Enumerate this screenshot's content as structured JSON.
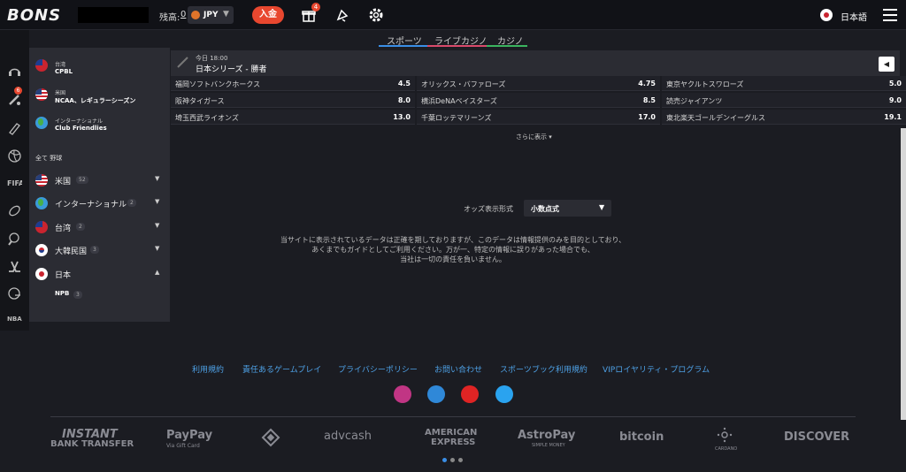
{
  "header": {
    "logo": "BONS",
    "balance_label": "残高:",
    "balance_value": "0",
    "currency": "JPY",
    "deposit_label": "入金",
    "gift_badge": "4",
    "language": "日本語"
  },
  "tabs": [
    {
      "label": "スポーツ",
      "color": "#3a8ee6"
    },
    {
      "label": "ライブカジノ",
      "color": "#d94a6b"
    },
    {
      "label": "カジノ",
      "color": "#3bb45f"
    }
  ],
  "sidebar": {
    "pinned": [
      {
        "line1": "台湾",
        "line2": "CPBL"
      },
      {
        "line1": "米国",
        "line2": "NCAA、レギュラーシーズン"
      },
      {
        "line1": "インターナショナル",
        "line2": "Club Friendlies"
      }
    ],
    "section_title": "全て 野球",
    "countries": [
      {
        "label": "米国",
        "count": "52"
      },
      {
        "label": "インターナショナル",
        "count": "2"
      },
      {
        "label": "台湾",
        "count": "2"
      },
      {
        "label": "大韓民国",
        "count": "3"
      },
      {
        "label": "日本",
        "count": ""
      }
    ],
    "expanded_league": {
      "label": "NPB",
      "count": "3"
    }
  },
  "event": {
    "time": "今日 18:00",
    "name": "日本シリーズ - 勝者",
    "odds": [
      {
        "team": "福岡ソフトバンクホークス",
        "value": "4.5"
      },
      {
        "team": "オリックス・バファローズ",
        "value": "4.75"
      },
      {
        "team": "東京ヤクルトスワローズ",
        "value": "5.0"
      },
      {
        "team": "阪神タイガース",
        "value": "8.0"
      },
      {
        "team": "横浜DeNAベイスターズ",
        "value": "8.5"
      },
      {
        "team": "読売ジャイアンツ",
        "value": "9.0"
      },
      {
        "team": "埼玉西武ライオンズ",
        "value": "13.0"
      },
      {
        "team": "千葉ロッテマリーンズ",
        "value": "17.0"
      },
      {
        "team": "東北楽天ゴールデンイーグルス",
        "value": "19.1"
      }
    ],
    "more_label": "さらに表示 ▾"
  },
  "odds_format": {
    "label": "オッズ表示形式",
    "value": "小数点式"
  },
  "disclaimer": [
    "当サイトに表示されているデータは正確を期しておりますが、このデータは情報提供のみを目的としており、",
    "あくまでもガイドとしてご利用ください。万が一、特定の情報に誤りがあった場合でも、",
    "当社は一切の責任を負いません。"
  ],
  "footer": {
    "links": [
      "利用規約",
      "責任あるゲームプレイ",
      "プライバシーポリシー",
      "お問い合わせ",
      "スポーツブック利用規約",
      "VIPロイヤリティ・プログラム"
    ],
    "social": [
      {
        "icon": "instagram-icon",
        "color": "#c13584"
      },
      {
        "icon": "blog-icon",
        "color": "#2f88d8"
      },
      {
        "icon": "youtube-icon",
        "color": "#e02424"
      },
      {
        "icon": "twitter-icon",
        "color": "#2aa3ef"
      }
    ],
    "payments": [
      {
        "line1": "INSTANT",
        "line2": "BANK TRANSFER"
      },
      {
        "line1": "PayPay",
        "line2": "Via Gift Card"
      },
      {
        "line1": "",
        "line2": ""
      },
      {
        "line1": "advcash",
        "line2": ""
      },
      {
        "line1": "AMERICAN",
        "line2": "EXPRESS"
      },
      {
        "line1": "AstroPay",
        "line2": "SIMPLE MONEY"
      },
      {
        "line1": "bitcoin",
        "line2": ""
      },
      {
        "line1": "",
        "line2": "CARDANO"
      },
      {
        "line1": "DISCOVER",
        "line2": ""
      }
    ]
  }
}
